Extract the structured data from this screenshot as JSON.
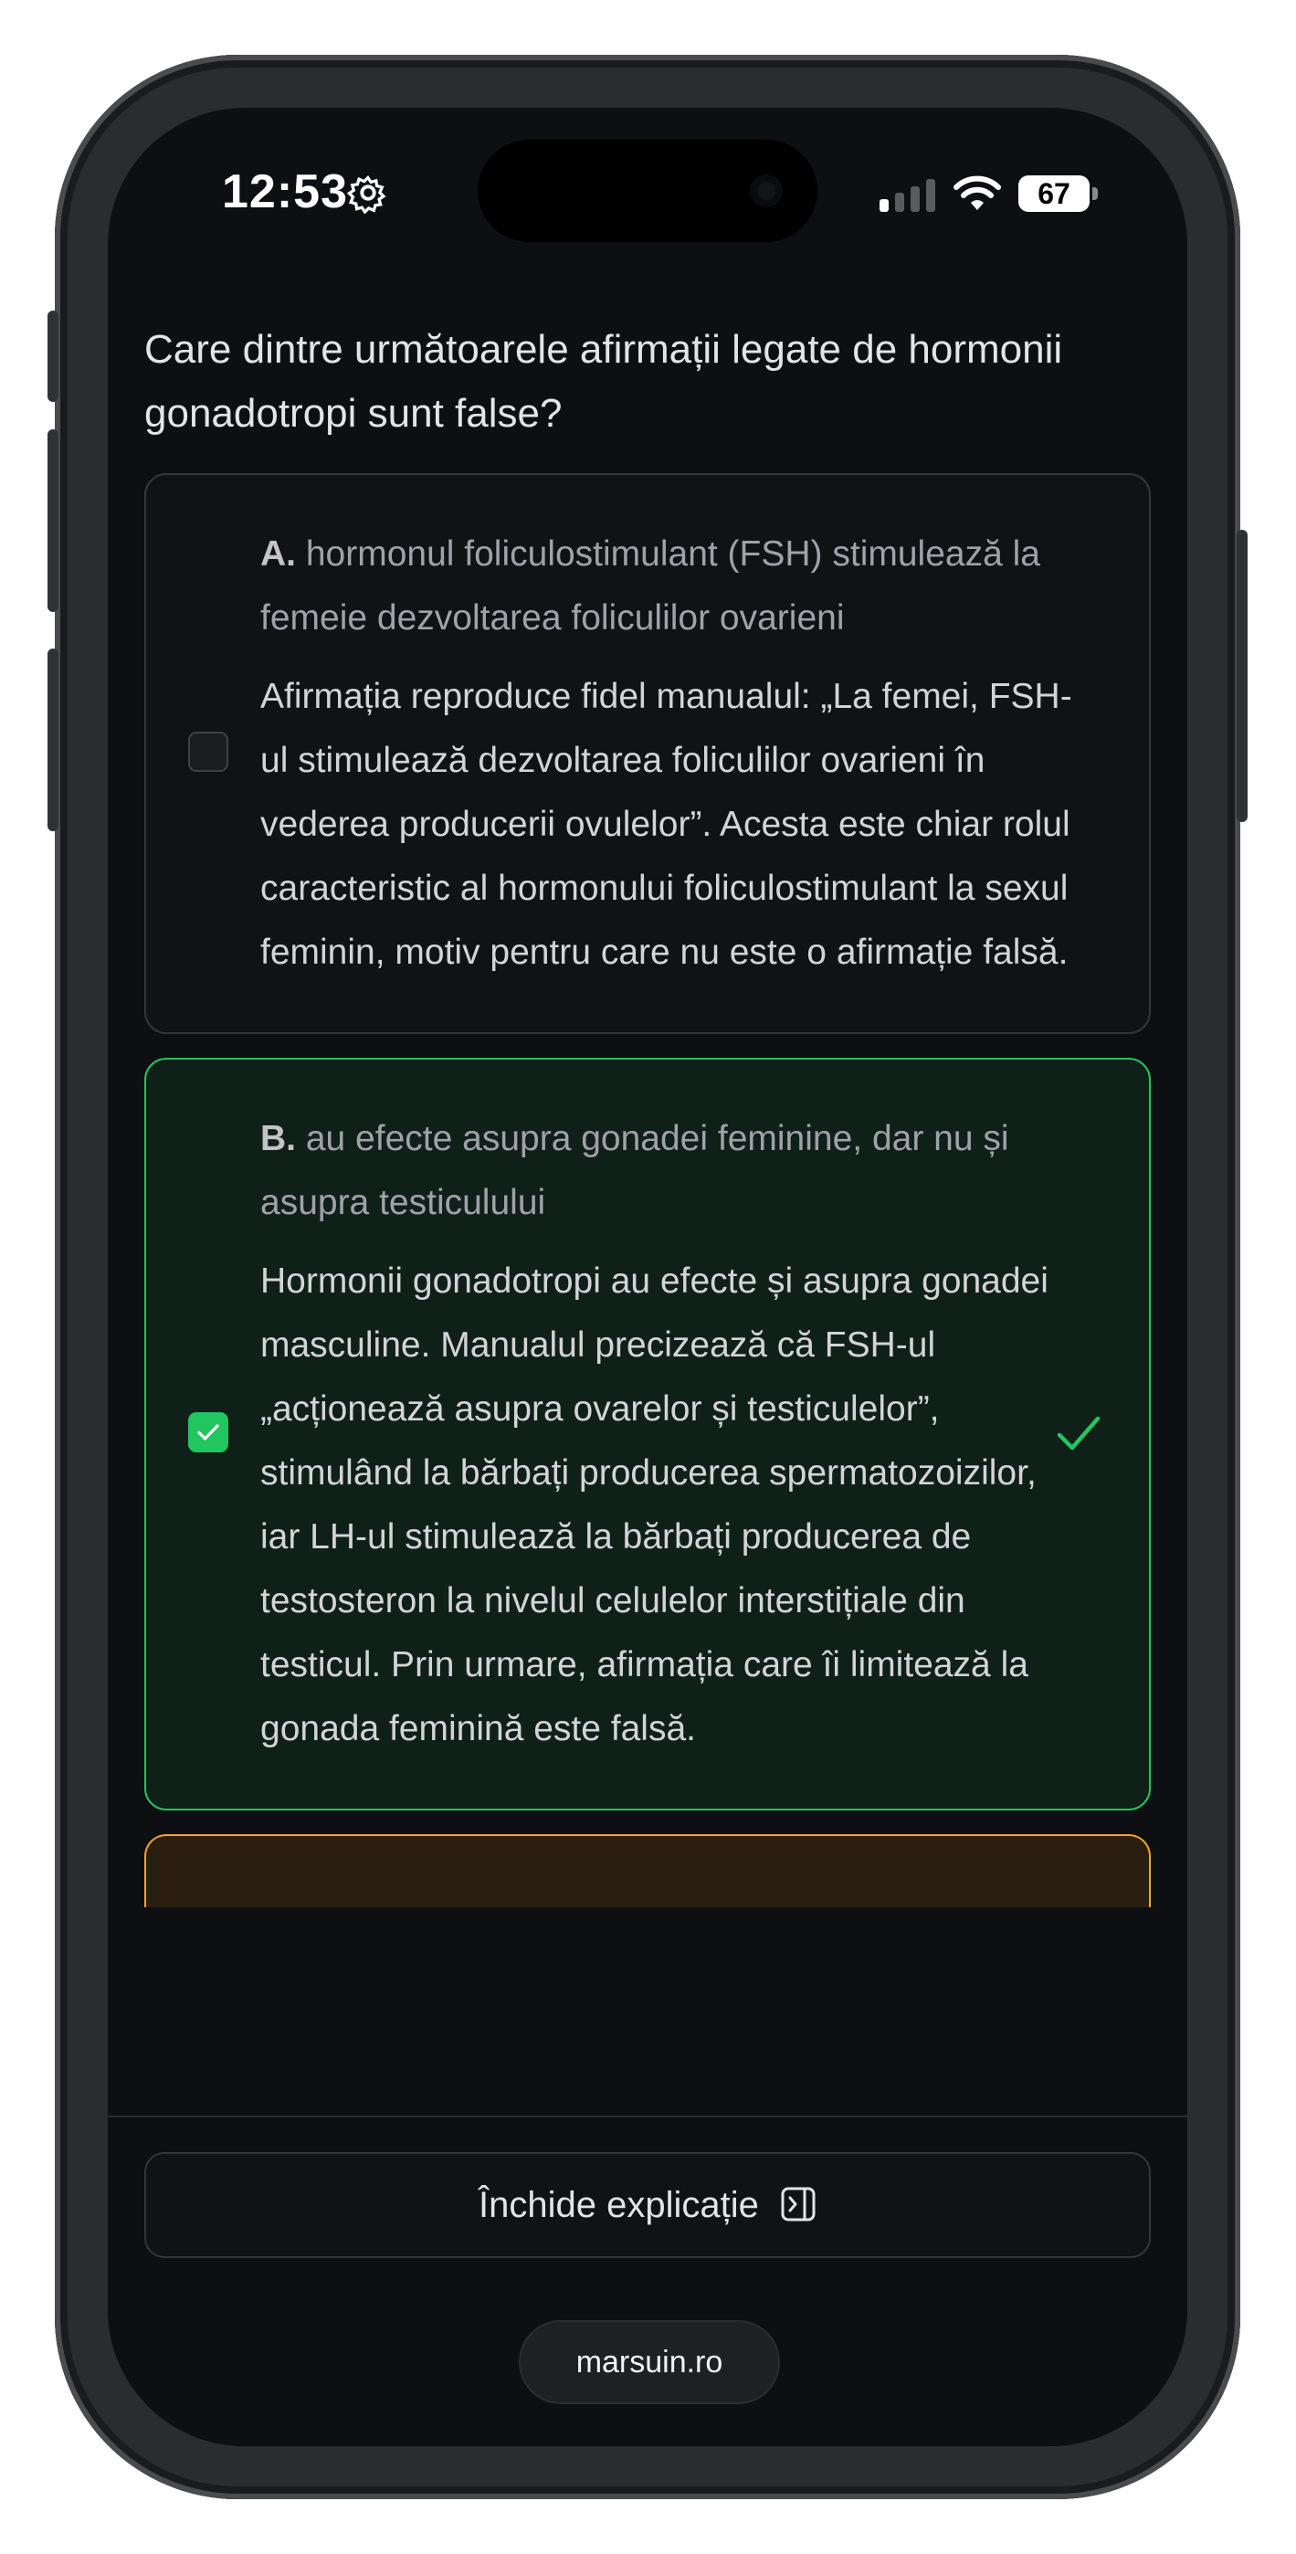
{
  "status_bar": {
    "time": "12:53",
    "battery": "67"
  },
  "quiz": {
    "question": "Care dintre următoarele afirmații legate de hormonii gonadotropi sunt false?",
    "options": [
      {
        "letter": "A.",
        "text": "hormonul foliculostimulant (FSH) stimulează la femeie dezvoltarea foliculilor ovarieni",
        "explanation": "Afirmația reproduce fidel manualul: „La femei, FSH-ul stimulează dezvoltarea foliculilor ovarieni în vederea producerii ovulelor”. Acesta este chiar rolul caracteristic al hormonului foliculostimulant la sexul feminin, motiv pentru care nu este o afirmație falsă.",
        "checked": false,
        "state": "neutral"
      },
      {
        "letter": "B.",
        "text": "au efecte asupra gonadei feminine, dar nu și asupra testiculului",
        "explanation": "Hormonii gonadotropi au efecte și asupra gonadei masculine. Manualul precizează că FSH-ul „acționează asupra ovarelor și testiculelor”, stimulând la bărbați producerea spermatozoizilor, iar LH-ul stimulează la bărbați producerea de testosteron la nivelul celulelor interstițiale din testicul. Prin urmare, afirmația care îi limitează la gonada feminină este falsă.",
        "checked": true,
        "state": "correct"
      }
    ]
  },
  "actions": {
    "close_explanation_label": "Închide explicație"
  },
  "browser": {
    "url": "marsuin.ro"
  },
  "icons": {
    "settings": "gear-icon",
    "signal": "cellular-signal-icon",
    "wifi": "wifi-icon",
    "battery": "battery-icon",
    "checkbox_check": "check-icon",
    "correct": "checkmark-icon",
    "close_panel": "panel-collapse-icon"
  },
  "colors": {
    "correct": "#22c55e",
    "warning": "#f5a524",
    "background": "#0e0f12"
  }
}
